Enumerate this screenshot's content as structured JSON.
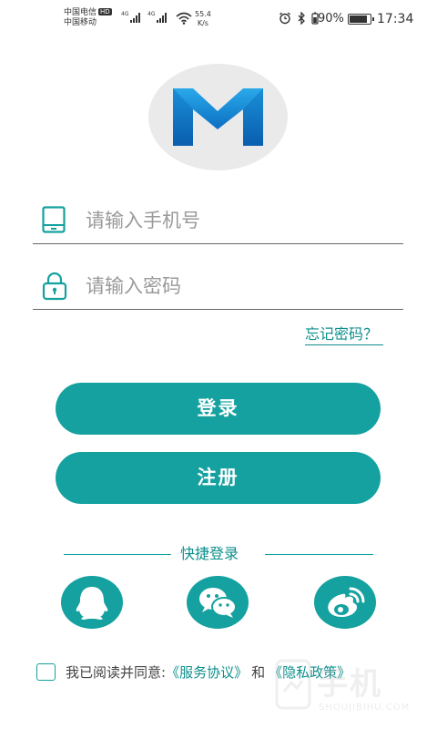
{
  "status_bar": {
    "carrier_1": "中国电信",
    "hd_badge": "HD",
    "carrier_2": "中国移动",
    "network_1": "4G",
    "network_2": "4G",
    "speed_value": "55.4",
    "speed_unit": "K/s",
    "battery_percent": "90%",
    "battery_level": 0.9,
    "time": "17:34"
  },
  "logo": {
    "icon": "m-logo-icon",
    "colors": [
      "#1e9ee0",
      "#0d72c4"
    ]
  },
  "login_form": {
    "phone_placeholder": "请输入手机号",
    "password_placeholder": "请输入密码",
    "phone_icon": "phone-icon",
    "password_icon": "lock-icon",
    "forgot_label": "忘记密码？",
    "login_label": "登录",
    "register_label": "注册"
  },
  "quick_login": {
    "title": "快捷登录",
    "providers": [
      {
        "icon": "qq-icon"
      },
      {
        "icon": "wechat-icon"
      },
      {
        "icon": "weibo-icon"
      }
    ]
  },
  "agreement": {
    "prefix": "我已阅读并同意:",
    "service_link": "《服务协议》",
    "and": "和",
    "privacy_link": "《隐私政策》"
  },
  "watermark": {
    "main": "手机",
    "sub": "SHOUJIBIHU.COM"
  },
  "colors": {
    "accent": "#14a19f",
    "link": "#0f8f8c"
  }
}
